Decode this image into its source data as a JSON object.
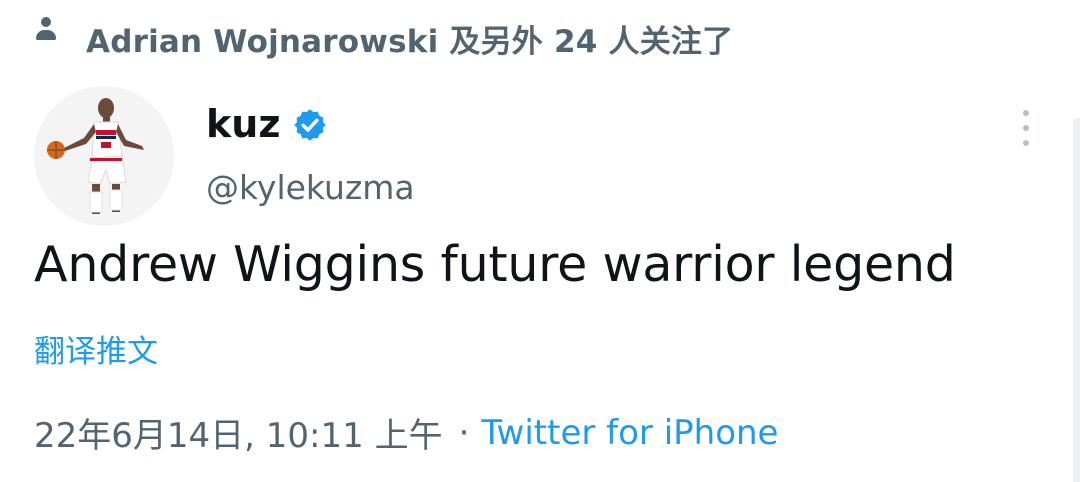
{
  "context": {
    "icon": "person-icon",
    "text": "Adrian Wojnarowski 及另外 24 人关注了"
  },
  "author": {
    "display_name": "kuz",
    "username": "@kylekuzma",
    "verified_icon": "verified-badge-icon",
    "avatar_icon": "basketball-player-avatar"
  },
  "tweet": {
    "text": "Andrew Wiggins future warrior legend",
    "translate_label": "翻译推文",
    "timestamp": "22年6月14日, 10:11 上午",
    "separator": "·",
    "source": "Twitter for iPhone"
  },
  "menu": {
    "icon": "more-vertical-icon"
  },
  "colors": {
    "link": "#1d9bf0",
    "secondary_text": "#536471",
    "primary_text": "#0f1419",
    "verified": "#1d9bf0"
  }
}
